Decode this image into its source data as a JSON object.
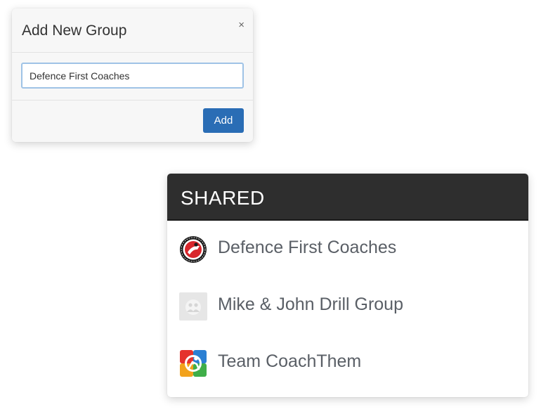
{
  "modal": {
    "title": "Add New Group",
    "close_glyph": "×",
    "input_value": "Defence First Coaches",
    "add_label": "Add"
  },
  "shared": {
    "title": "SHARED",
    "items": [
      {
        "label": "Defence First Coaches",
        "icon": "defence-first-logo-icon"
      },
      {
        "label": "Mike & John Drill Group",
        "icon": "group-placeholder-icon"
      },
      {
        "label": "Team CoachThem",
        "icon": "coachthem-logo-icon"
      }
    ]
  },
  "colors": {
    "accent": "#2a6db5",
    "header_dark": "#2e2e2e",
    "input_focus": "#9fc3e6"
  }
}
